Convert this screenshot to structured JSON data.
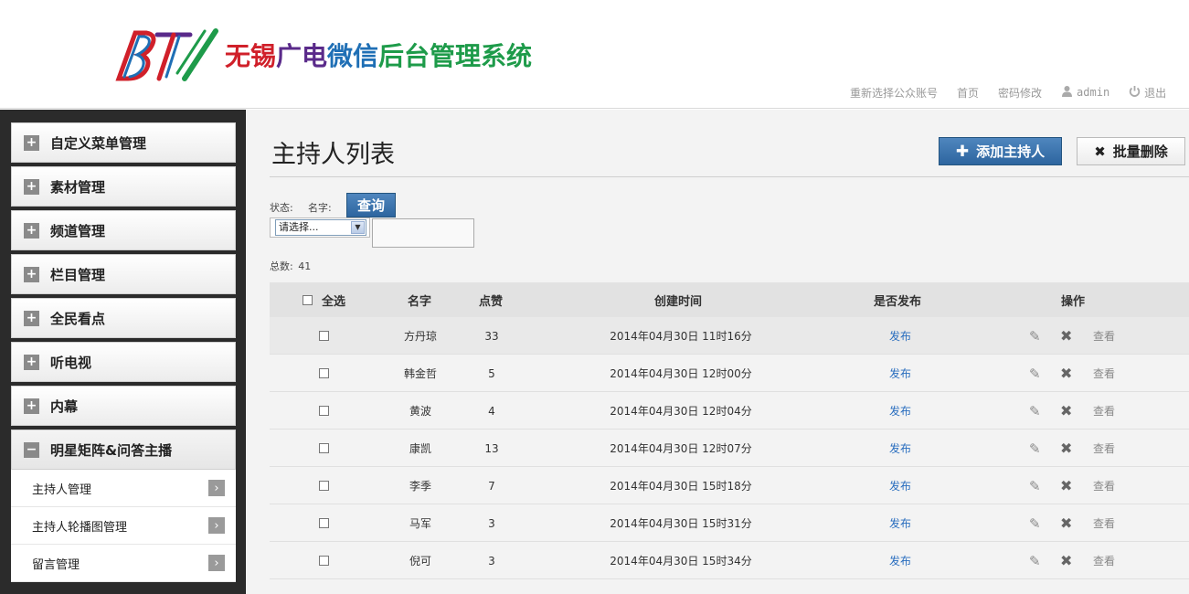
{
  "header": {
    "title_parts": [
      "无锡",
      "广电",
      "微信",
      "后台管理系统"
    ],
    "nav": {
      "reselect": "重新选择公众账号",
      "home": "首页",
      "password": "密码修改",
      "user": "admin",
      "logout": "退出"
    }
  },
  "sidebar": {
    "items": [
      {
        "label": "自定义菜单管理",
        "icon": "plus-icon"
      },
      {
        "label": "素材管理",
        "icon": "plus-icon"
      },
      {
        "label": "频道管理",
        "icon": "plus-icon"
      },
      {
        "label": "栏目管理",
        "icon": "plus-icon"
      },
      {
        "label": "全民看点",
        "icon": "plus-icon"
      },
      {
        "label": "听电视",
        "icon": "plus-icon"
      },
      {
        "label": "内幕",
        "icon": "plus-icon"
      },
      {
        "label": "明星矩阵&问答主播",
        "icon": "minus-icon",
        "expanded": true
      }
    ],
    "subitems": [
      {
        "label": "主持人管理"
      },
      {
        "label": "主持人轮播图管理"
      },
      {
        "label": "留言管理"
      }
    ]
  },
  "main": {
    "title": "主持人列表",
    "add_button": "添加主持人",
    "batch_delete_button": "批量删除",
    "filter": {
      "status_label": "状态:",
      "name_label": "名字:",
      "query_button": "查询",
      "status_selected": "请选择...",
      "name_value": ""
    },
    "total_label": "总数:",
    "total_value": "41"
  },
  "table": {
    "headers": {
      "select_all": "全选",
      "name": "名字",
      "likes": "点赞",
      "created": "创建时间",
      "published": "是否发布",
      "actions": "操作"
    },
    "rows": [
      {
        "name": "方丹琼",
        "likes": "33",
        "created": "2014年04月30日  11时16分",
        "publish": "发布",
        "view": "查看"
      },
      {
        "name": "韩金哲",
        "likes": "5",
        "created": "2014年04月30日  12时00分",
        "publish": "发布",
        "view": "查看"
      },
      {
        "name": "黄波",
        "likes": "4",
        "created": "2014年04月30日  12时04分",
        "publish": "发布",
        "view": "查看"
      },
      {
        "name": "康凯",
        "likes": "13",
        "created": "2014年04月30日  12时07分",
        "publish": "发布",
        "view": "查看"
      },
      {
        "name": "李季",
        "likes": "7",
        "created": "2014年04月30日  15时18分",
        "publish": "发布",
        "view": "查看"
      },
      {
        "name": "马军",
        "likes": "3",
        "created": "2014年04月30日  15时31分",
        "publish": "发布",
        "view": "查看"
      },
      {
        "name": "倪可",
        "likes": "3",
        "created": "2014年04月30日  15时34分",
        "publish": "发布",
        "view": "查看"
      }
    ]
  }
}
